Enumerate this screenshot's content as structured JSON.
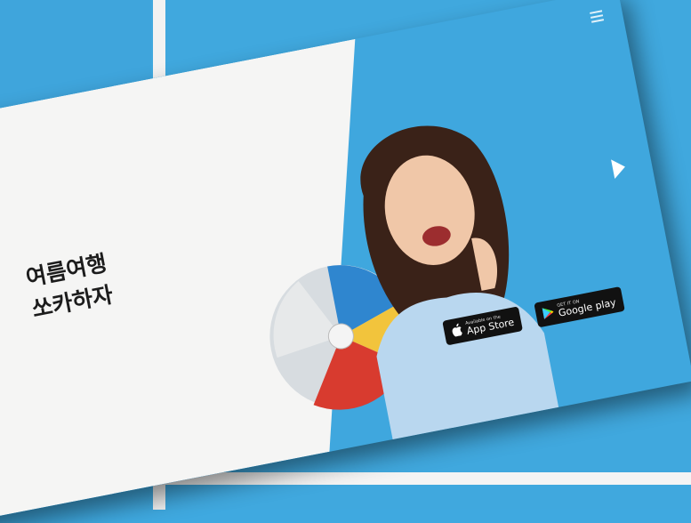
{
  "hero": {
    "headline": "여름여행\n쏘카하자"
  },
  "badges": {
    "app_store": {
      "small": "Available on the",
      "large": "App Store"
    },
    "google_play": {
      "small": "GET IT ON",
      "large": "Google play"
    }
  },
  "colors": {
    "brand_blue": "#3fa7de",
    "panel_white": "#f5f5f4",
    "badge_black": "#111111"
  },
  "icons": [
    "menu-icon",
    "next-arrow-icon",
    "apple-icon",
    "google-play-icon"
  ]
}
